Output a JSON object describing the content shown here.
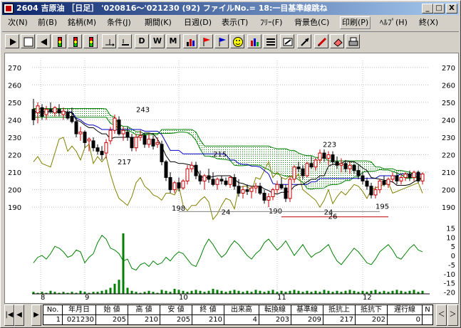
{
  "window": {
    "title": "2604 吉原油 ［日足］ '020816～'021230 (92) ファイルNo.= 18:一目基準線跳ね",
    "minimize_glyph": "_",
    "maximize_glyph": "□",
    "close_glyph": "X"
  },
  "menu": {
    "items": [
      {
        "label": "次(N)"
      },
      {
        "label": "前(B)"
      },
      {
        "label": "銘柄(M)"
      },
      {
        "label": "条件(J)"
      },
      {
        "label": "期間(K)"
      },
      {
        "label": "日週(D)"
      },
      {
        "label": "表示(T)"
      },
      {
        "label": "ﾌﾘｰ(F)"
      },
      {
        "label": "背景色(C)"
      },
      {
        "label": "印刷(P)"
      },
      {
        "label": "ﾍﾙﾌﾟ(H)"
      },
      {
        "label": "終(X)"
      }
    ]
  },
  "toolbar": {
    "buttons": [
      {
        "icon": "play-right-icon"
      },
      {
        "icon": "blank-page-icon"
      },
      {
        "icon": "play-left-icon"
      },
      {
        "icon": "traffic-light-icon"
      },
      {
        "icon": "traffic-light-icon"
      },
      {
        "icon": "traffic-light-icon"
      },
      {
        "icon": "split-arrow-icon"
      },
      {
        "icon": "underline-icon"
      },
      {
        "label": "D"
      },
      {
        "label": "W"
      },
      {
        "label": "M"
      },
      {
        "icon": "bar-chart-icon"
      },
      {
        "icon": "red-flag-icon"
      },
      {
        "icon": "blue-flag-icon"
      },
      {
        "icon": "smiley-icon"
      },
      {
        "icon": "colored-bars-icon"
      },
      {
        "icon": "lines-icon"
      },
      {
        "icon": "gauge-icon"
      },
      {
        "icon": "diagonal-arrow-icon"
      },
      {
        "icon": "pencil-icon"
      },
      {
        "icon": "eraser-icon"
      },
      {
        "icon": "printer-icon"
      }
    ]
  },
  "chart_data": [
    {
      "type": "candlestick",
      "price_axis_ticks": [
        "270",
        "260",
        "250",
        "240",
        "230",
        "220",
        "210",
        "200",
        "190"
      ],
      "ylim": [
        186,
        274
      ],
      "month_labels": [
        "8",
        "9",
        "10",
        "11",
        "12"
      ],
      "annotations": [
        "243",
        "217",
        "215",
        "198",
        "190",
        "223",
        "195",
        "24",
        "24",
        "26"
      ],
      "colors": {
        "up": "#c00000",
        "down": "#000000",
        "tenkan": "#000000",
        "kijun": "#0000c0",
        "cloud_a": "#008000",
        "chikou": "#808000"
      },
      "candles": [
        [
          246,
          252,
          237,
          240
        ],
        [
          244,
          250,
          238,
          248
        ],
        [
          247,
          249,
          240,
          242
        ],
        [
          243,
          248,
          240,
          246
        ],
        [
          246,
          250,
          244,
          245
        ],
        [
          244,
          248,
          242,
          247
        ],
        [
          246,
          249,
          242,
          244
        ],
        [
          243,
          247,
          240,
          245
        ],
        [
          244,
          246,
          240,
          241
        ],
        [
          242,
          247,
          238,
          239
        ],
        [
          239,
          241,
          230,
          232
        ],
        [
          232,
          236,
          228,
          233
        ],
        [
          233,
          234,
          224,
          227
        ],
        [
          228,
          230,
          222,
          229
        ],
        [
          228,
          230,
          222,
          224
        ],
        [
          224,
          226,
          220,
          222
        ],
        [
          222,
          225,
          217,
          220
        ],
        [
          221,
          229,
          218,
          227
        ],
        [
          228,
          236,
          226,
          234
        ],
        [
          234,
          243,
          232,
          241
        ],
        [
          240,
          242,
          231,
          232
        ],
        [
          232,
          236,
          228,
          234
        ],
        [
          233,
          236,
          228,
          230
        ],
        [
          230,
          232,
          222,
          224
        ],
        [
          224,
          232,
          222,
          230
        ],
        [
          230,
          234,
          228,
          231
        ],
        [
          231,
          232,
          224,
          226
        ],
        [
          226,
          232,
          224,
          229
        ],
        [
          229,
          231,
          223,
          225
        ],
        [
          226,
          230,
          224,
          227
        ],
        [
          226,
          228,
          214,
          216
        ],
        [
          216,
          217,
          205,
          207
        ],
        [
          207,
          210,
          198,
          200
        ],
        [
          200,
          205,
          198,
          204
        ],
        [
          204,
          207,
          199,
          201
        ],
        [
          201,
          206,
          200,
          205
        ],
        [
          205,
          214,
          203,
          212
        ],
        [
          212,
          216,
          210,
          214
        ],
        [
          214,
          216,
          206,
          208
        ],
        [
          208,
          211,
          203,
          205
        ],
        [
          205,
          209,
          200,
          208
        ],
        [
          208,
          212,
          204,
          206
        ],
        [
          206,
          210,
          202,
          203
        ],
        [
          203,
          207,
          200,
          206
        ],
        [
          206,
          208,
          203,
          205
        ],
        [
          205,
          207,
          202,
          203
        ],
        [
          203,
          208,
          201,
          207
        ],
        [
          207,
          209,
          200,
          202
        ],
        [
          202,
          206,
          196,
          198
        ],
        [
          198,
          202,
          195,
          200
        ],
        [
          200,
          203,
          197,
          199
        ],
        [
          199,
          202,
          195,
          201
        ],
        [
          201,
          204,
          198,
          202
        ],
        [
          202,
          204,
          197,
          198
        ],
        [
          198,
          200,
          192,
          194
        ],
        [
          194,
          198,
          190,
          196
        ],
        [
          196,
          201,
          194,
          200
        ],
        [
          200,
          205,
          198,
          203
        ],
        [
          203,
          207,
          200,
          201
        ],
        [
          201,
          203,
          193,
          195
        ],
        [
          195,
          208,
          193,
          206
        ],
        [
          206,
          214,
          204,
          213
        ],
        [
          213,
          216,
          210,
          212
        ],
        [
          212,
          214,
          206,
          208
        ],
        [
          208,
          216,
          207,
          215
        ],
        [
          215,
          219,
          212,
          213
        ],
        [
          213,
          218,
          211,
          217
        ],
        [
          217,
          223,
          215,
          221
        ],
        [
          221,
          223,
          216,
          218
        ],
        [
          218,
          222,
          214,
          220
        ],
        [
          220,
          222,
          214,
          216
        ],
        [
          216,
          219,
          212,
          214
        ],
        [
          214,
          218,
          210,
          215
        ],
        [
          215,
          217,
          210,
          212
        ],
        [
          212,
          216,
          209,
          214
        ],
        [
          214,
          215,
          209,
          211
        ],
        [
          211,
          214,
          206,
          208
        ],
        [
          208,
          210,
          203,
          205
        ],
        [
          205,
          207,
          200,
          202
        ],
        [
          202,
          204,
          195,
          197
        ],
        [
          197,
          202,
          195,
          200
        ],
        [
          200,
          206,
          198,
          205
        ],
        [
          205,
          208,
          202,
          203
        ],
        [
          203,
          207,
          201,
          206
        ],
        [
          206,
          210,
          204,
          208
        ],
        [
          208,
          210,
          203,
          205
        ],
        [
          205,
          209,
          203,
          207
        ],
        [
          207,
          210,
          205,
          209
        ],
        [
          209,
          211,
          205,
          207
        ],
        [
          207,
          211,
          205,
          210
        ],
        [
          210,
          211,
          204,
          205
        ],
        [
          205,
          210,
          203,
          209
        ]
      ]
    },
    {
      "type": "line",
      "ticks": [
        "15",
        "10",
        "5",
        "0",
        "-5",
        "-10",
        "-15",
        "-20"
      ],
      "ylim": [
        -21,
        16
      ],
      "values": [
        -4,
        -1,
        0,
        -2,
        1,
        5,
        4,
        2,
        -1,
        0,
        3,
        2,
        -4,
        -1,
        1,
        7,
        11,
        9,
        4,
        3,
        1,
        -3,
        -2,
        -7,
        -8,
        -5,
        -4,
        -6,
        -3,
        -5,
        -4,
        -1,
        -3,
        0,
        2,
        1,
        -2,
        -5,
        -6,
        -1,
        5,
        9,
        6,
        2,
        -1,
        1,
        5,
        8,
        6,
        3,
        0,
        -2,
        1,
        3,
        7,
        9,
        6,
        3,
        5,
        8,
        4,
        0,
        3,
        6,
        2,
        -1,
        1,
        2,
        4,
        6,
        1,
        -3,
        -5,
        -2,
        1,
        4,
        2,
        -1,
        -4,
        -5,
        -2,
        2,
        4,
        6,
        3,
        -1,
        -2,
        1,
        4,
        6,
        3,
        2
      ],
      "xlim": [
        0,
        91
      ]
    },
    {
      "type": "bar",
      "values": [
        2,
        1,
        2,
        1,
        3,
        2,
        1,
        2,
        1,
        2,
        1,
        3,
        2,
        1,
        2,
        2,
        3,
        4,
        6,
        10,
        14,
        20,
        6,
        3,
        2,
        1,
        2,
        3,
        2,
        1,
        4,
        3,
        2,
        5,
        4,
        3,
        2,
        3,
        4,
        3,
        2,
        3,
        5,
        4,
        3,
        2,
        3,
        4,
        3,
        2,
        3,
        2,
        4,
        3,
        2,
        3,
        4,
        2,
        3,
        2,
        3,
        4,
        3,
        2,
        3,
        2,
        3,
        2,
        4,
        3,
        2,
        3,
        2,
        3,
        4,
        3,
        2,
        3,
        2,
        3,
        4,
        2,
        3,
        2,
        3,
        4,
        3,
        2,
        3,
        4,
        2,
        3
      ],
      "spike_index": 21,
      "spike_value": 60,
      "color": "#008000"
    }
  ],
  "grid": {
    "nav_left": "|◀",
    "nav_prev": "◀",
    "nav_mid": "▶",
    "nav_up": "＜",
    "nav_down": "＞",
    "nav_right": "▶",
    "headers": [
      "No.",
      "年月日",
      "始 値",
      "高 値",
      "安 値",
      "終 値",
      "出来高",
      "転換線",
      "基準線",
      "抵抗上",
      "抵抗下",
      "遅行線",
      "N"
    ],
    "values": [
      "1",
      "021230",
      "205",
      "210",
      "205",
      "210",
      "4",
      "203",
      "209",
      "217",
      "202",
      "0",
      ""
    ]
  }
}
